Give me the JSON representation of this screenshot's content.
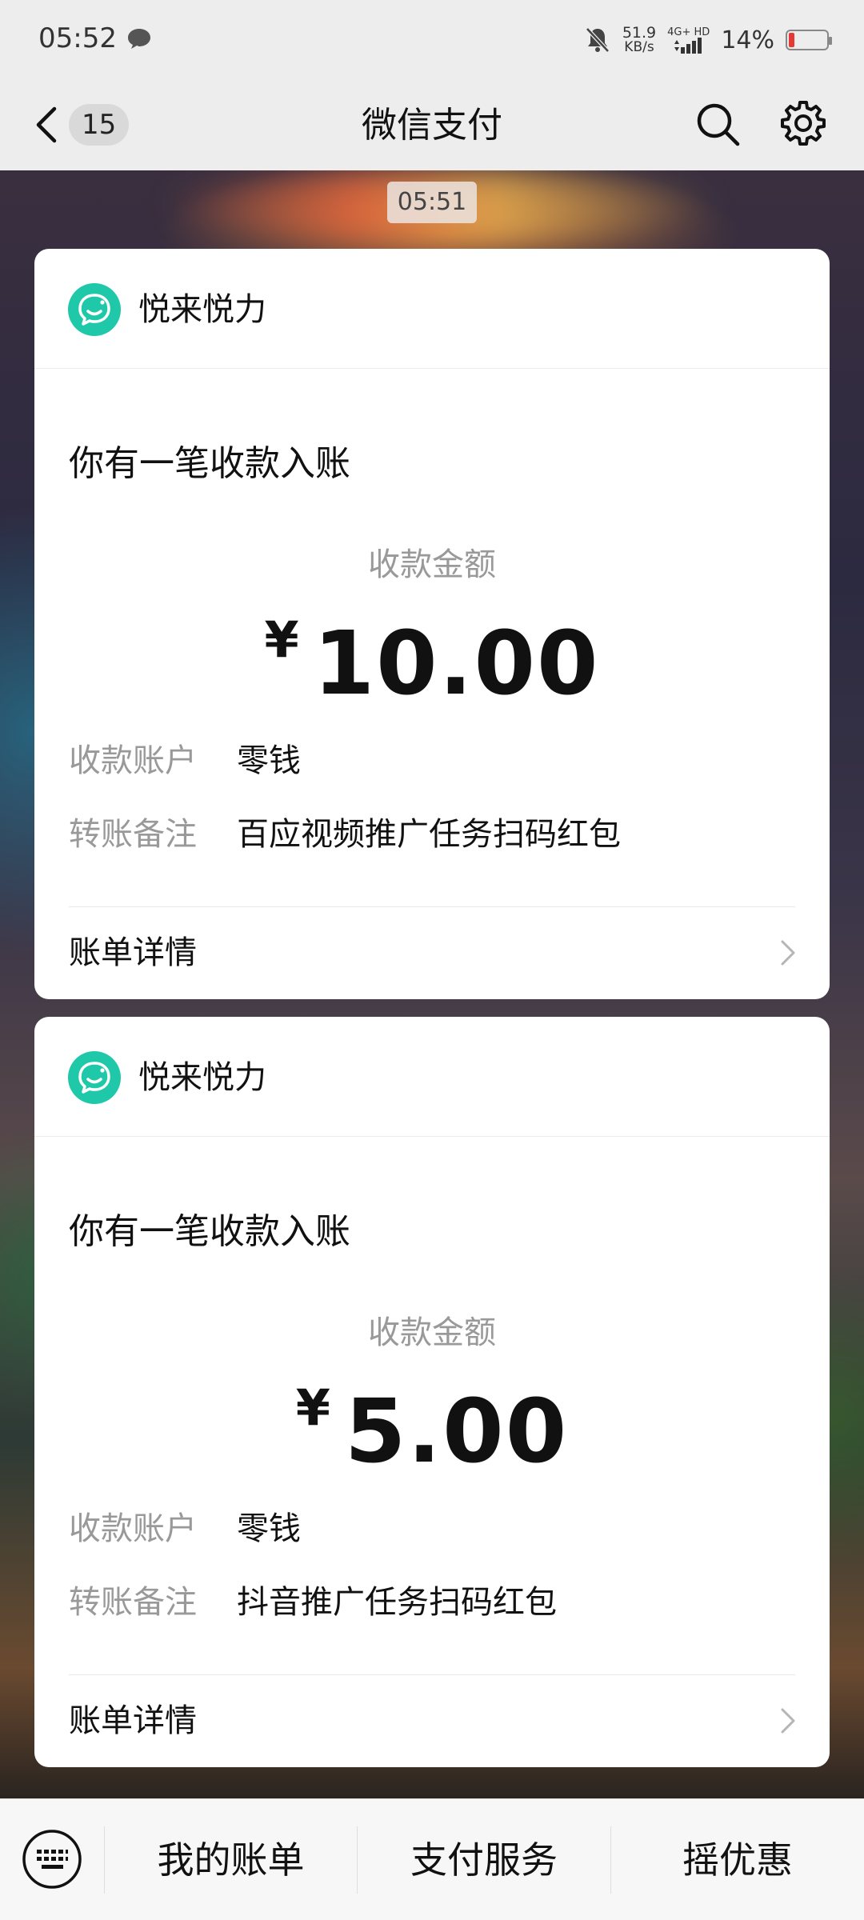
{
  "status_bar": {
    "time": "05:52",
    "net_speed_value": "51.9",
    "net_speed_unit": "KB/s",
    "network_type": "4G+ HD",
    "battery_percent": "14%",
    "battery_level": 0.14,
    "battery_color": "#e53935"
  },
  "nav": {
    "back_count": "15",
    "title": "微信支付"
  },
  "timestamp": "05:51",
  "cards": [
    {
      "merchant": "悦来悦力",
      "title": "你有一笔收款入账",
      "amount_label": "收款金额",
      "currency": "¥",
      "amount": "10.00",
      "account_label": "收款账户",
      "account_value": "零钱",
      "note_label": "转账备注",
      "note_value": "百应视频推广任务扫码红包",
      "bill_link": "账单详情"
    },
    {
      "merchant": "悦来悦力",
      "title": "你有一笔收款入账",
      "amount_label": "收款金额",
      "currency": "¥",
      "amount": "5.00",
      "account_label": "收款账户",
      "account_value": "零钱",
      "note_label": "转账备注",
      "note_value": "抖音推广任务扫码红包",
      "bill_link": "账单详情"
    }
  ],
  "bottom_menu": {
    "items": [
      "我的账单",
      "支付服务",
      "摇优惠"
    ]
  },
  "colors": {
    "merchant_logo": "#1ec8a8",
    "page_bg": "#ededed"
  },
  "icons": [
    "chat-bubble-icon",
    "bell-muted-icon",
    "back-arrow-icon",
    "search-icon",
    "gear-icon",
    "smile-logo-icon",
    "chevron-right-icon",
    "keyboard-icon"
  ]
}
